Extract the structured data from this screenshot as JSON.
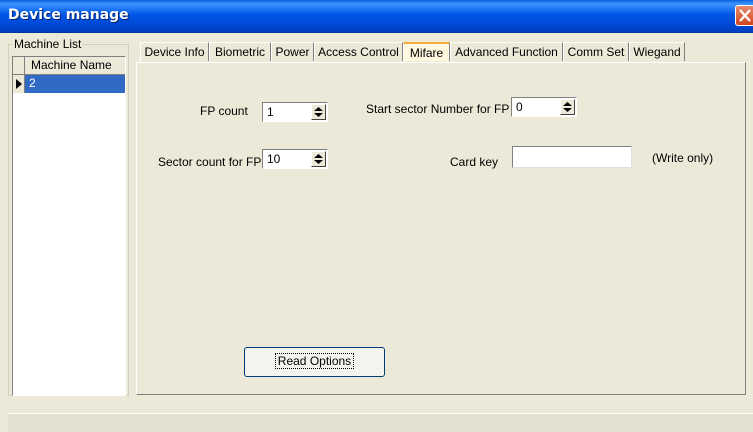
{
  "window": {
    "title": "Device manage"
  },
  "machine_list": {
    "label": "Machine List",
    "column_header": "Machine Name",
    "rows": [
      {
        "name": "2"
      }
    ]
  },
  "tabs": [
    {
      "label": "Device Info",
      "active": false
    },
    {
      "label": "Biometric",
      "active": false
    },
    {
      "label": "Power",
      "active": false
    },
    {
      "label": "Access Control",
      "active": false
    },
    {
      "label": "Mifare",
      "active": true
    },
    {
      "label": "Advanced Function",
      "active": false
    },
    {
      "label": "Comm Set",
      "active": false
    },
    {
      "label": "Wiegand",
      "active": false
    }
  ],
  "mifare": {
    "fp_count_label": "FP count",
    "fp_count_value": "1",
    "start_sector_label": "Start sector Number for FP",
    "start_sector_value": "0",
    "sector_count_label": "Sector count for FP",
    "sector_count_value": "10",
    "card_key_label": "Card key",
    "card_key_value": "",
    "card_key_note": "(Write only)"
  },
  "actions": {
    "read_options_label": "Read Options"
  },
  "colors": {
    "titlebar": "#0054e3",
    "selection": "#316ac5",
    "active_tab_accent": "#f0b040",
    "close_button": "#d1461f"
  }
}
